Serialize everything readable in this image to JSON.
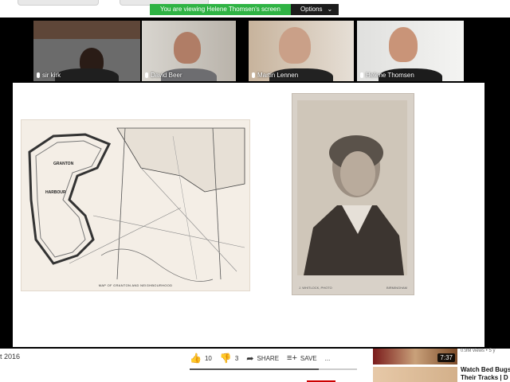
{
  "zoom": {
    "share_banner": "You are viewing Helene Thomsen's screen",
    "options_label": "Options",
    "participants": [
      {
        "name": "sir kirk",
        "active": false
      },
      {
        "name": "David Beer",
        "active": false
      },
      {
        "name": "Martin Lennen",
        "active": false
      },
      {
        "name": "Helene Thomsen",
        "active": true
      }
    ],
    "slide": {
      "map_labels": [
        "GRANTON",
        "HARBOUR",
        "MAP OF GRANTON AND NEIGHBOURHOOD"
      ],
      "portrait_caption_left": "J. WHITLOCK, PHOTO",
      "portrait_caption_right": "BIRMINGHAM"
    }
  },
  "youtube": {
    "date_fragment": "t 2016",
    "likes": "10",
    "dislikes": "3",
    "share_label": "SHARE",
    "save_label": "SAVE",
    "more_label": "...",
    "like_ratio": 0.77,
    "recommendations": [
      {
        "meta": "0.9M views • 5 y",
        "duration": "7:37"
      },
      {
        "title_line1": "Watch Bed Bugs",
        "title_line2": "Their Tracks | D"
      }
    ]
  },
  "colors": {
    "banner_green": "#2fb344",
    "active_speaker": "#8fd14f",
    "zoom_bg": "#000000"
  }
}
